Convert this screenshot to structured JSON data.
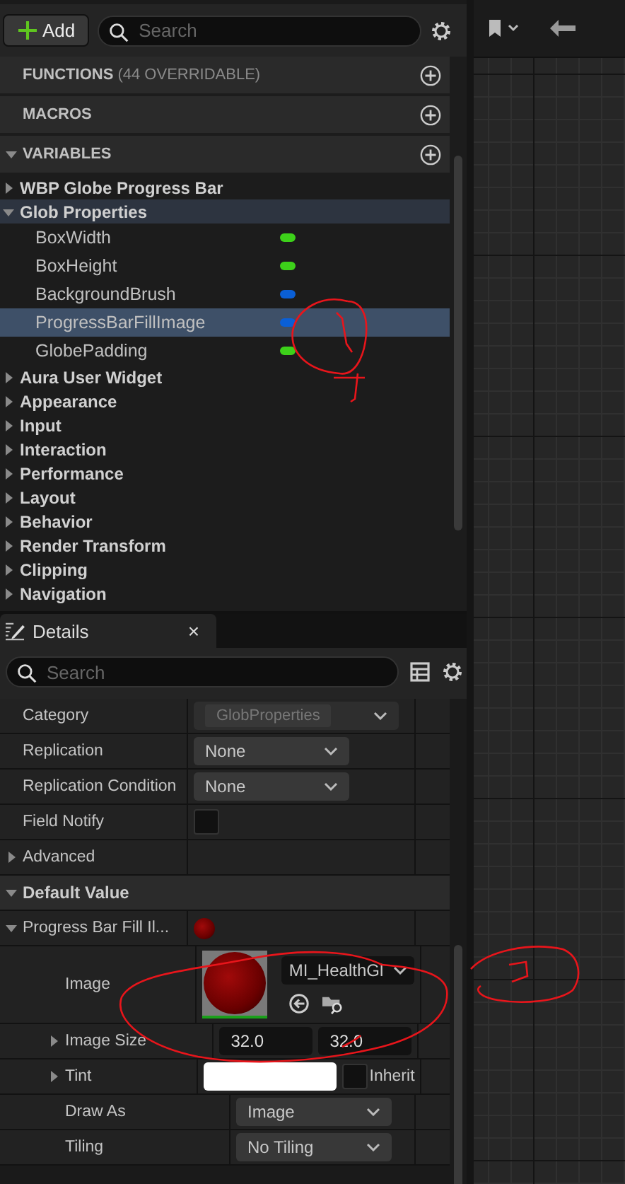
{
  "toolbar": {
    "add_label": "Add",
    "search_placeholder": "Search"
  },
  "sections": [
    {
      "title": "FUNCTIONS",
      "note": "(44 OVERRIDABLE)"
    },
    {
      "title": "MACROS"
    },
    {
      "title": "VARIABLES",
      "expanded": true
    }
  ],
  "variable_tree": [
    {
      "label": "WBP Globe Progress Bar",
      "expanded": false,
      "highlighted": false
    },
    {
      "label": "Glob Properties",
      "expanded": true,
      "highlighted": true,
      "children": [
        {
          "label": "BoxWidth",
          "color": "#3dd11a",
          "selected": false
        },
        {
          "label": "BoxHeight",
          "color": "#3dd11a",
          "selected": false
        },
        {
          "label": "BackgroundBrush",
          "color": "#0a5fd6",
          "selected": false
        },
        {
          "label": "ProgressBarFillImage",
          "color": "#0a5fd6",
          "selected": true
        },
        {
          "label": "GlobePadding",
          "color": "#3dd11a",
          "selected": false
        }
      ]
    },
    {
      "label": "Aura User Widget",
      "expanded": false,
      "highlighted": false
    },
    {
      "label": "Appearance",
      "expanded": false,
      "highlighted": false
    },
    {
      "label": "Input",
      "expanded": false,
      "highlighted": false
    },
    {
      "label": "Interaction",
      "expanded": false,
      "highlighted": false
    },
    {
      "label": "Performance",
      "expanded": false,
      "highlighted": false
    },
    {
      "label": "Layout",
      "expanded": false,
      "highlighted": false
    },
    {
      "label": "Behavior",
      "expanded": false,
      "highlighted": false
    },
    {
      "label": "Render Transform",
      "expanded": false,
      "highlighted": false
    },
    {
      "label": "Clipping",
      "expanded": false,
      "highlighted": false
    },
    {
      "label": "Navigation",
      "expanded": false,
      "highlighted": false
    }
  ],
  "details": {
    "tab": "Details",
    "close": "×",
    "search_placeholder": "Search",
    "rows": [
      {
        "kind": "dropdown",
        "label": "Category",
        "value": "GlobProperties",
        "disabled": true
      },
      {
        "kind": "dropdown",
        "label": "Replication",
        "value": "None",
        "disabled": false
      },
      {
        "kind": "dropdown",
        "label": "Replication Condition",
        "value": "None",
        "disabled": false
      },
      {
        "kind": "checkbox",
        "label": "Field Notify",
        "checked": false
      },
      {
        "kind": "group",
        "label": "Advanced",
        "expanded": false
      },
      {
        "kind": "header",
        "label": "Default Value",
        "expanded": true
      },
      {
        "kind": "asset",
        "label": "Progress Bar Fill Il...",
        "expanded": true,
        "children": [
          {
            "kind": "image",
            "label": "Image",
            "value": "MI_HealthGl"
          },
          {
            "kind": "vector",
            "label": "Image Size",
            "expanded": false,
            "values": [
              "32.0",
              "32.0"
            ]
          },
          {
            "kind": "color",
            "label": "Tint",
            "expanded": false,
            "inherit_label": "Inherit",
            "inherit_checked": false
          },
          {
            "kind": "dropdown",
            "label": "Draw As",
            "value": "Image",
            "disabled": false
          },
          {
            "kind": "dropdown",
            "label": "Tiling",
            "value": "No Tiling",
            "disabled": false
          }
        ]
      }
    ]
  }
}
